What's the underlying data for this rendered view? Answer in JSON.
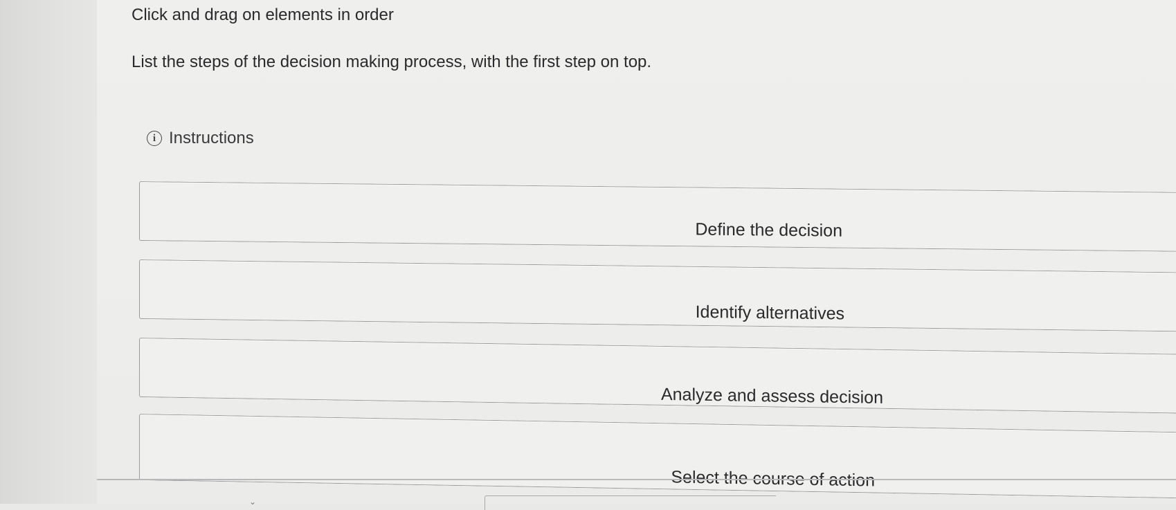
{
  "question": {
    "header": "Click and drag on elements in order",
    "prompt": "List the steps of the decision making process, with the first step on top.",
    "instructions_label": "Instructions",
    "instructions_icon": "info-icon"
  },
  "items": [
    {
      "label": "Define the decision"
    },
    {
      "label": "Identify alternatives"
    },
    {
      "label": "Analyze and assess decision"
    },
    {
      "label": "Select the course of action"
    }
  ]
}
